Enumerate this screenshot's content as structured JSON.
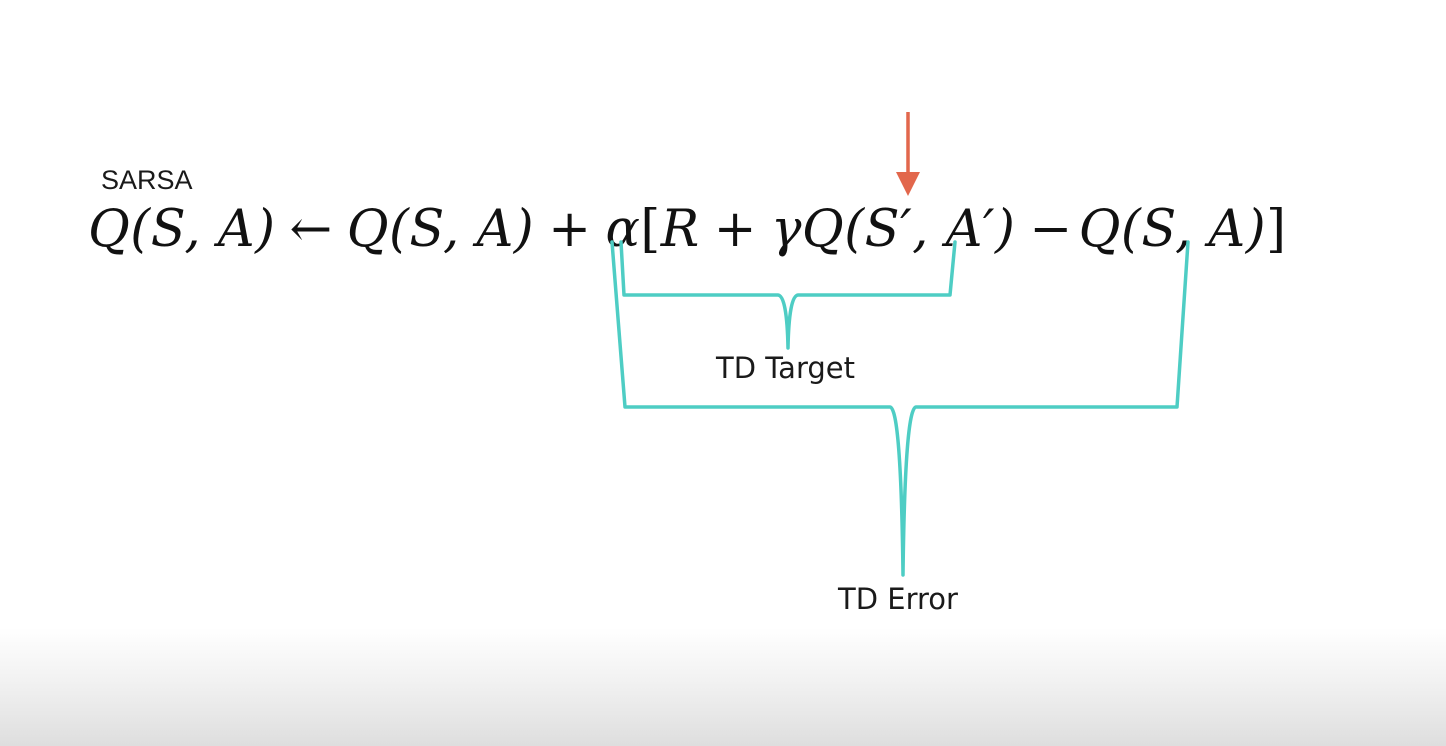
{
  "title": "SARSA",
  "equation": {
    "lhs": "Q(S, A)",
    "arrow": "←",
    "q": "Q(S, A)",
    "plus": "+",
    "alpha": "α",
    "open_bracket": "[",
    "r": "R",
    "gamma": "γ",
    "q_next": "Q(S′, A′)",
    "minus": "−",
    "q_again": "Q(S, A)",
    "close_bracket": "]"
  },
  "annotations": {
    "td_target": "TD Target",
    "td_error": "TD Error"
  },
  "colors": {
    "bracket": "#4ecdc4",
    "arrow": "#e2674c",
    "text": "#1a1a1a"
  }
}
